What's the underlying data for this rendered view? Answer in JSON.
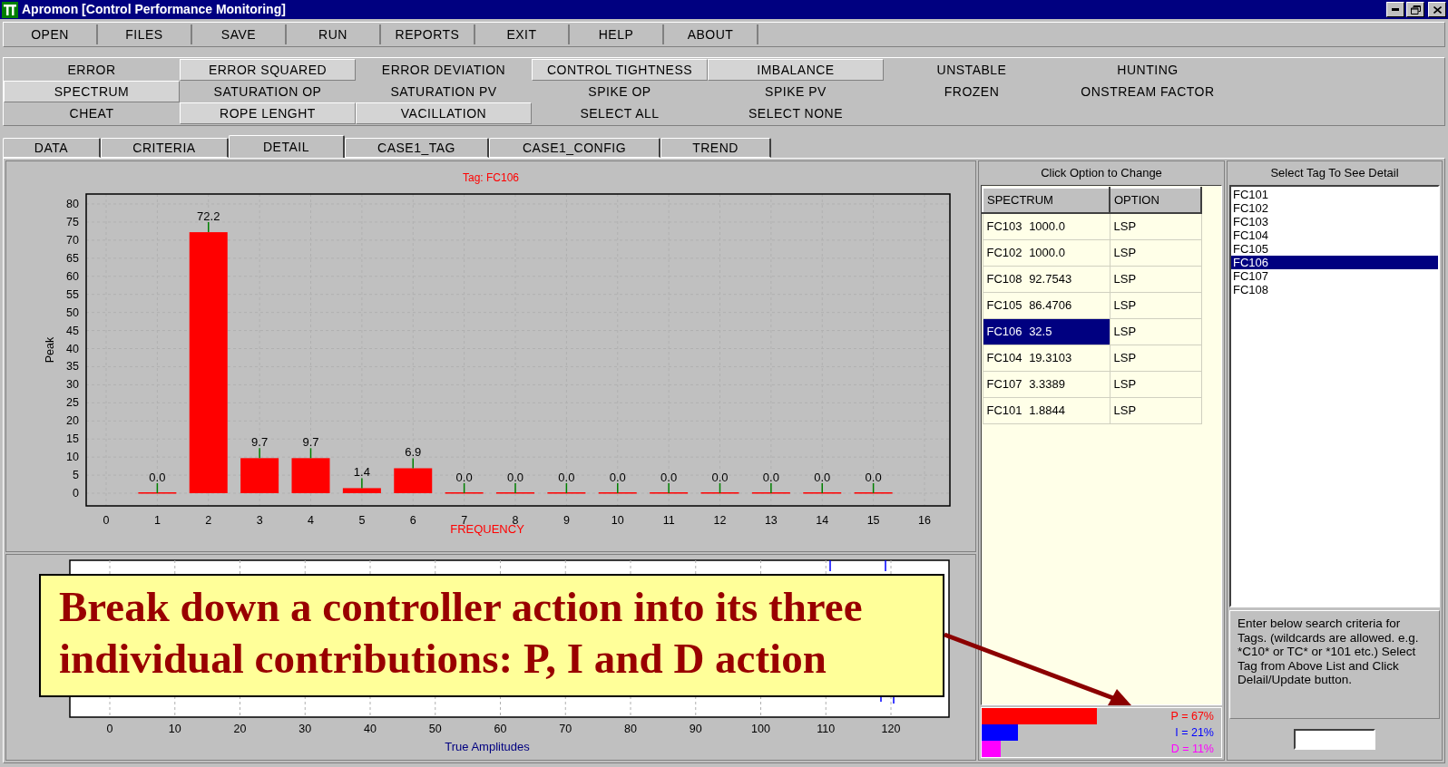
{
  "window": {
    "title": "Apromon [Control Performance Monitoring]"
  },
  "menu": [
    {
      "label": "OPEN"
    },
    {
      "label": "FILES"
    },
    {
      "label": "SAVE"
    },
    {
      "label": "RUN"
    },
    {
      "label": "REPORTS"
    },
    {
      "label": "EXIT"
    },
    {
      "label": "HELP"
    },
    {
      "label": "ABOUT"
    }
  ],
  "criteria": [
    [
      {
        "label": "ERROR",
        "selected": false
      },
      {
        "label": "ERROR SQUARED",
        "selected": true
      },
      {
        "label": "ERROR DEVIATION",
        "selected": false
      },
      {
        "label": "CONTROL TIGHTNESS",
        "selected": true
      },
      {
        "label": "IMBALANCE",
        "selected": true
      },
      {
        "label": "UNSTABLE",
        "selected": false
      },
      {
        "label": "HUNTING",
        "selected": false
      }
    ],
    [
      {
        "label": "SPECTRUM",
        "selected": true
      },
      {
        "label": "SATURATION OP",
        "selected": false
      },
      {
        "label": "SATURATION PV",
        "selected": false
      },
      {
        "label": "SPIKE OP",
        "selected": false
      },
      {
        "label": "SPIKE PV",
        "selected": false
      },
      {
        "label": "FROZEN",
        "selected": false
      },
      {
        "label": "ONSTREAM FACTOR",
        "selected": false
      }
    ],
    [
      {
        "label": "CHEAT",
        "selected": false
      },
      {
        "label": "ROPE LENGHT",
        "selected": true
      },
      {
        "label": "VACILLATION",
        "selected": true
      },
      {
        "label": "SELECT ALL",
        "selected": false
      },
      {
        "label": "SELECT NONE",
        "selected": false
      }
    ]
  ],
  "tabs": [
    {
      "label": "DATA",
      "selected": false
    },
    {
      "label": "CRITERIA",
      "selected": false
    },
    {
      "label": "DETAIL",
      "selected": true
    },
    {
      "label": "CASE1_TAG",
      "selected": false
    },
    {
      "label": "CASE1_CONFIG",
      "selected": false
    },
    {
      "label": "TREND",
      "selected": false
    }
  ],
  "spectrum_chart": {
    "chart_data": {
      "type": "bar",
      "title": "Tag: FC106",
      "xlabel": "FREQUENCY",
      "ylabel": "Peak",
      "x": [
        1,
        2,
        3,
        4,
        5,
        6,
        7,
        8,
        9,
        10,
        11,
        12,
        13,
        14,
        15
      ],
      "grid": true,
      "series": [
        {
          "color": "#ff0000",
          "values": [
            0.0,
            72.2,
            9.7,
            9.7,
            1.4,
            6.9,
            0.0,
            0.0,
            0.0,
            0.0,
            0.0,
            0.0,
            0.0,
            0.0,
            0.0
          ]
        }
      ],
      "value_labels": [
        "0.0",
        "72.2",
        "9.7",
        "9.7",
        "1.4",
        "6.9",
        "0.0",
        "0.0",
        "0.0",
        "0.0",
        "0.0",
        "0.0",
        "0.0",
        "0.0",
        "0.0"
      ],
      "xlim": [
        0,
        16
      ],
      "ylim": [
        0,
        80
      ],
      "xticks": [
        0,
        1,
        2,
        3,
        4,
        5,
        6,
        7,
        8,
        9,
        10,
        11,
        12,
        13,
        14,
        15,
        16
      ],
      "yticks": [
        0,
        5,
        10,
        15,
        20,
        25,
        30,
        35,
        40,
        45,
        50,
        55,
        60,
        65,
        70,
        75,
        80
      ]
    }
  },
  "amplitude_chart": {
    "xlabel": "True Amplitudes",
    "xticks": [
      "0",
      "10",
      "20",
      "30",
      "40",
      "50",
      "60",
      "70",
      "80",
      "90",
      "100",
      "110",
      "120"
    ]
  },
  "callout": {
    "text": "Break down a controller action into its three individual contributions: P, I and D action"
  },
  "options_panel": {
    "header": "Click Option to Change",
    "columns": [
      "SPECTRUM",
      "OPTION"
    ],
    "rows": [
      {
        "spectrum": "FC103 1000.0",
        "option": "LSP",
        "selected": false
      },
      {
        "spectrum": "FC102 1000.0",
        "option": "LSP",
        "selected": false
      },
      {
        "spectrum": "FC108 92.7543",
        "option": "LSP",
        "selected": false
      },
      {
        "spectrum": "FC105 86.4706",
        "option": "LSP",
        "selected": false
      },
      {
        "spectrum": "FC106 32.5",
        "option": "LSP",
        "selected": true
      },
      {
        "spectrum": "FC104 19.3103",
        "option": "LSP",
        "selected": false
      },
      {
        "spectrum": "FC107 3.3389",
        "option": "LSP",
        "selected": false
      },
      {
        "spectrum": "FC101 1.8844",
        "option": "LSP",
        "selected": false
      }
    ],
    "pid": [
      {
        "label": "P = 67%",
        "color": "#ff0000"
      },
      {
        "label": "I = 21%",
        "color": "#0000ff"
      },
      {
        "label": "D = 11%",
        "color": "#ff00ff"
      }
    ]
  },
  "tag_panel": {
    "header": "Select Tag To See Detail",
    "tags": [
      {
        "label": "FC101",
        "selected": false
      },
      {
        "label": "FC102",
        "selected": false
      },
      {
        "label": "FC103",
        "selected": false
      },
      {
        "label": "FC104",
        "selected": false
      },
      {
        "label": "FC105",
        "selected": false
      },
      {
        "label": "FC106",
        "selected": true
      },
      {
        "label": "FC107",
        "selected": false
      },
      {
        "label": "FC108",
        "selected": false
      }
    ],
    "help": "Enter below search criteria for Tags. (wildcards are allowed. e.g. *C10* or TC* or *101 etc.) Select Tag from Above List and Click Delail/Update button."
  }
}
